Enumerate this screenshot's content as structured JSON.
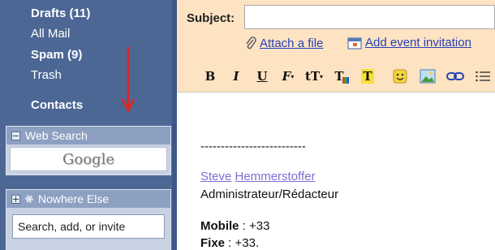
{
  "sidebar": {
    "nav": [
      {
        "label": "Drafts (11)",
        "bold": true
      },
      {
        "label": "All Mail",
        "bold": false
      },
      {
        "label": "Spam (9)",
        "bold": true
      },
      {
        "label": "Trash",
        "bold": false
      },
      {
        "label": "Contacts",
        "bold": true
      }
    ],
    "web_search": {
      "title": "Web Search",
      "logo_text": "Google"
    },
    "chat": {
      "title": "Nowhere Else",
      "input_placeholder": "Search, add, or invite"
    }
  },
  "compose": {
    "subject_label": "Subject:",
    "subject_value": "",
    "attach_label": "Attach a file",
    "event_label": "Add event invitation",
    "toolbar": {
      "bold": "B",
      "italic": "I",
      "underline": "U",
      "font": "F",
      "size": "tT",
      "text_color": "T",
      "highlight": "T"
    },
    "body": {
      "separator": "--------------------------",
      "sig_first": "Steve",
      "sig_last": "Hemmerstoffer",
      "role": "Administrateur/Rédacteur",
      "mobile_label": "Mobile",
      "mobile_value": " : +33",
      "fixe_label": "Fixe",
      "fixe_value": " : +33."
    }
  },
  "colors": {
    "sidebar_bg": "#4d6795",
    "compose_header": "#fde3c2",
    "arrow": "#d62a2a",
    "link": "#2642b8"
  }
}
